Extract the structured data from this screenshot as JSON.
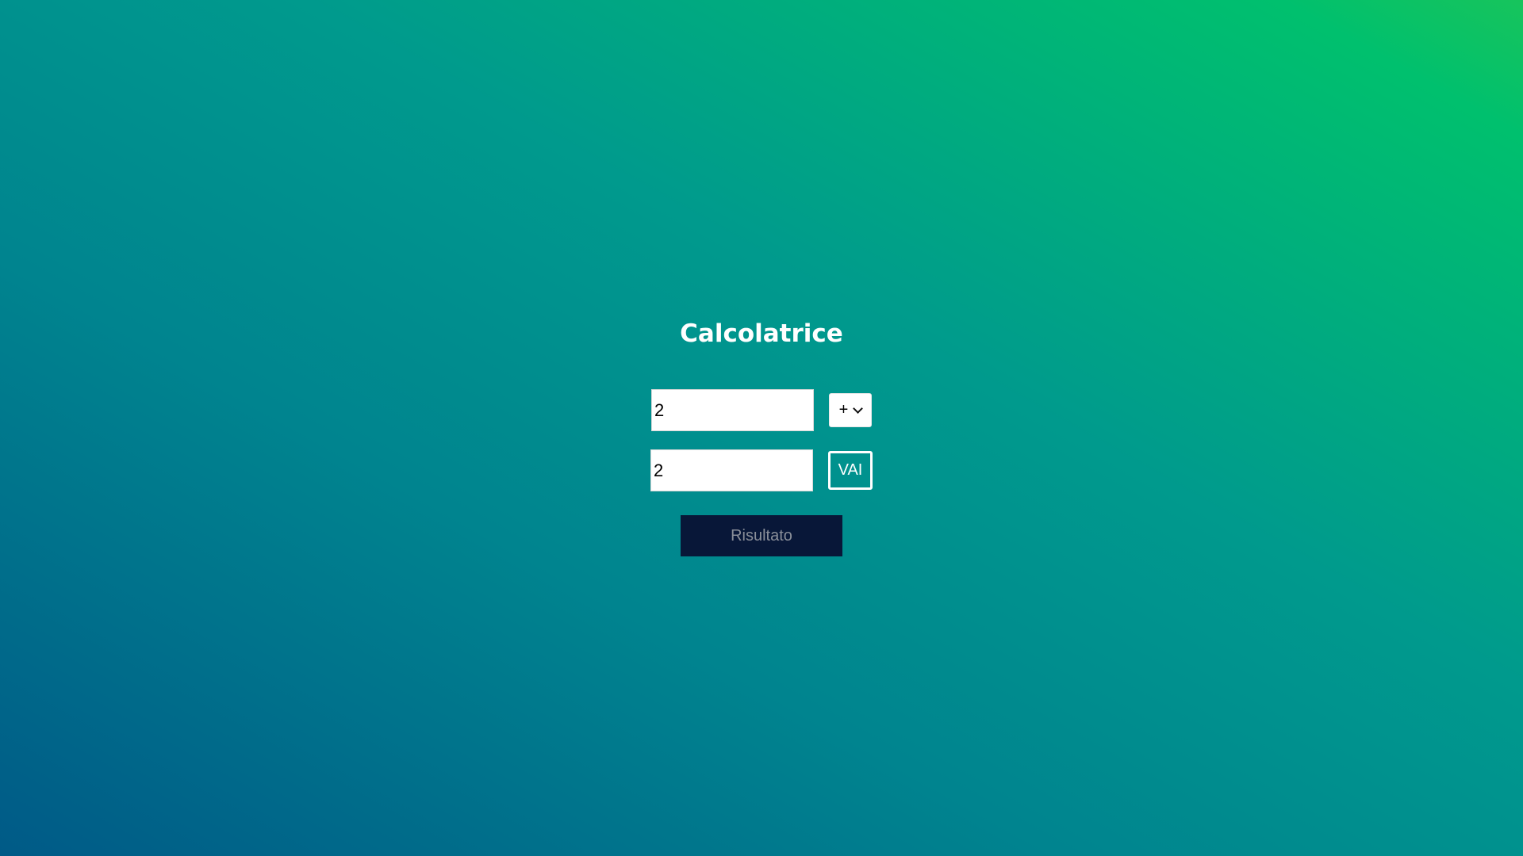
{
  "app": {
    "title": "Calcolatrice"
  },
  "calculator": {
    "first_operand": "2",
    "operator": "+",
    "second_operand": "2",
    "submit_label": "VAI",
    "result_label": "Risultato"
  },
  "colors": {
    "gradient_start": "#005a87",
    "gradient_end": "#17c45c",
    "result_background": "#081738",
    "text_light": "#ffffff"
  }
}
